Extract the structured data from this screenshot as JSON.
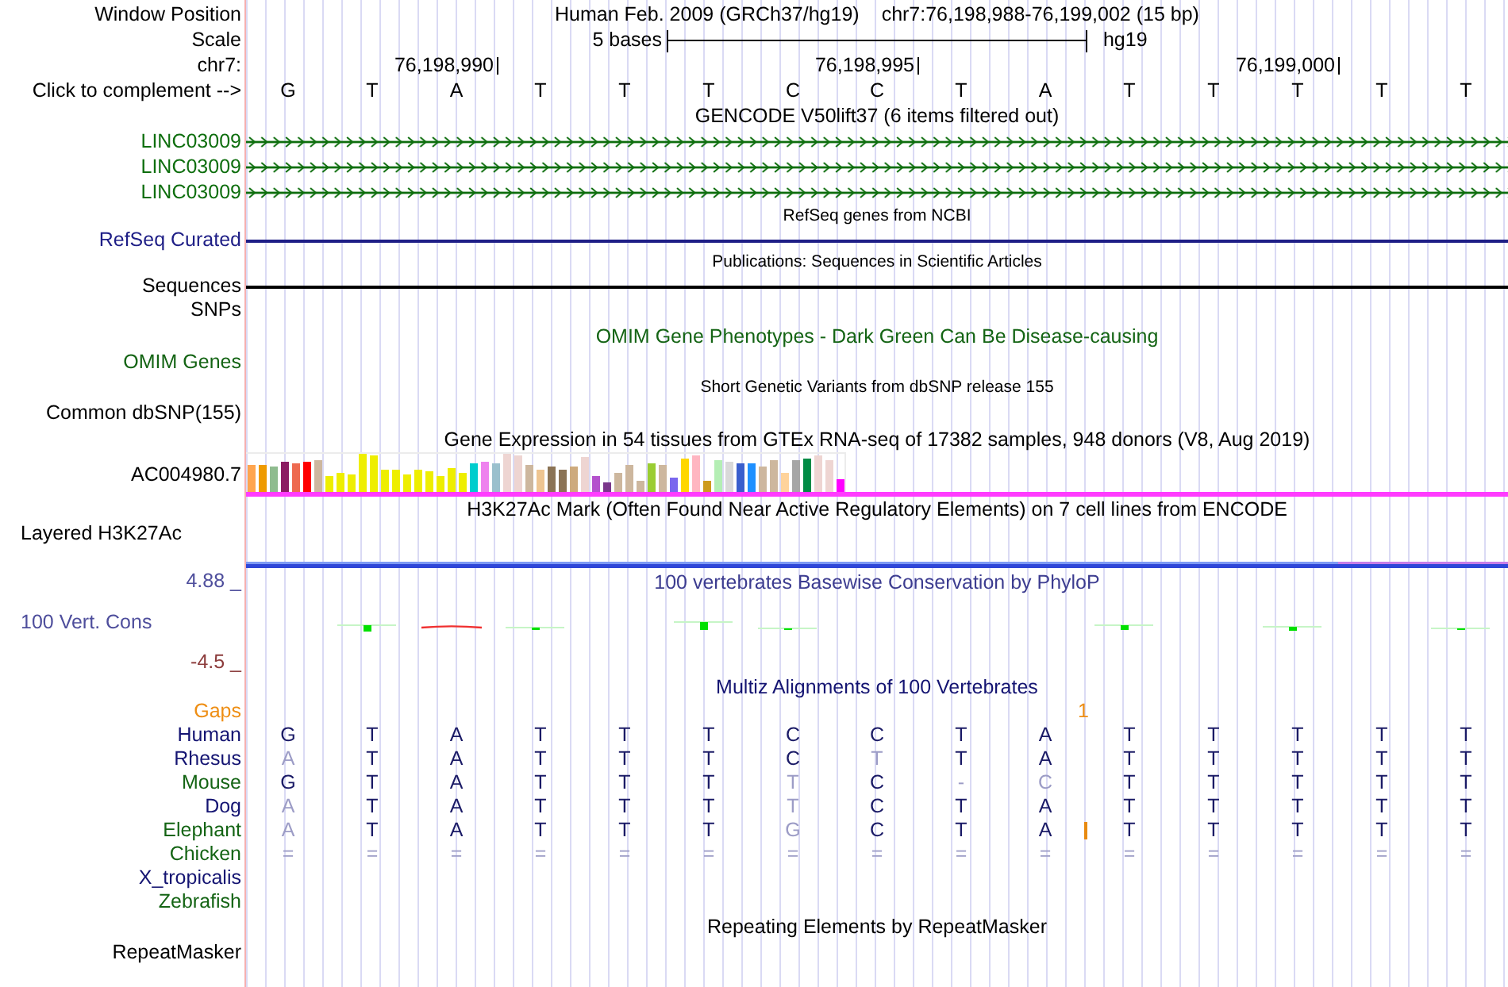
{
  "position": {
    "label": "Window Position",
    "assembly": "Human Feb. 2009 (GRCh37/hg19)",
    "range": "chr7:76,198,988-76,199,002 (15 bp)"
  },
  "scale": {
    "label": "Scale",
    "span": "5 bases",
    "assembly": "hg19"
  },
  "ruler": {
    "label": "chr7:"
  },
  "sequence": {
    "label": "Click to complement -->",
    "bases": [
      {
        "base": "G"
      },
      {
        "base": "T"
      },
      {
        "base": "A",
        "coordinate": "76,198,990"
      },
      {
        "base": "T"
      },
      {
        "base": "T"
      },
      {
        "base": "T"
      },
      {
        "base": "C"
      },
      {
        "base": "C",
        "coordinate": "76,198,995"
      },
      {
        "base": "T"
      },
      {
        "base": "A"
      },
      {
        "base": "T"
      },
      {
        "base": "T"
      },
      {
        "base": "T",
        "coordinate": "76,199,000"
      },
      {
        "base": "T"
      },
      {
        "base": "T"
      }
    ]
  },
  "rows": [
    {
      "kind": "title",
      "text": "GENCODE V50lift37 (6 items filtered out)",
      "color": "#000000"
    },
    {
      "kind": "gene",
      "label": "LINC03009",
      "color": "#0e6e0e"
    },
    {
      "kind": "gene",
      "label": "LINC03009",
      "color": "#0e6e0e"
    },
    {
      "kind": "gene",
      "label": "LINC03009",
      "color": "#0e6e0e"
    },
    {
      "kind": "caption",
      "text": "RefSeq genes from NCBI",
      "color": "#000000"
    },
    {
      "kind": "line",
      "label": "RefSeq Curated",
      "color": "#1e1e86"
    },
    {
      "kind": "caption",
      "text": "Publications: Sequences in Scientific Articles",
      "color": "#000000"
    },
    {
      "kind": "line",
      "label": "Sequences",
      "color": "#000000"
    },
    {
      "kind": "label",
      "label": "SNPs",
      "color": "#000000"
    },
    {
      "kind": "title",
      "text": "OMIM Gene Phenotypes - Dark Green Can Be Disease-causing",
      "color": "#146414"
    },
    {
      "kind": "label",
      "label": "OMIM Genes",
      "color": "#146414"
    },
    {
      "kind": "caption",
      "text": "Short Genetic Variants from dbSNP release 155",
      "color": "#000000"
    },
    {
      "kind": "label",
      "label": "Common dbSNP(155)",
      "color": "#000000"
    },
    {
      "kind": "title",
      "text": "Gene Expression in 54 tissues from GTEx RNA-seq of 17382 samples, 948 donors (V8, Aug 2019)",
      "color": "#000000"
    },
    {
      "kind": "expression",
      "label": "AC004980.7",
      "color": "#000000"
    },
    {
      "kind": "title",
      "text": "H3K27Ac Mark (Often Found Near Active Regulatory Elements) on 7 cell lines from ENCODE",
      "color": "#000000"
    },
    {
      "kind": "signal",
      "label": "Layered H3K27Ac",
      "color": "#000000"
    },
    {
      "kind": "conservation",
      "title": "100 vertebrates Basewise Conservation by PhyloP",
      "label": "100 Vert. Cons",
      "max": "4.88 _",
      "min": "-4.5 _",
      "color": "#4e4e9c"
    },
    {
      "kind": "title",
      "text": "Multiz Alignments of 100 Vertebrates",
      "color": "#141472"
    },
    {
      "kind": "gaps",
      "label": "Gaps",
      "color": "#ee8e14"
    },
    {
      "kind": "species",
      "label": "Human",
      "color": "#141472",
      "bases": [
        {
          "base": "G",
          "match": true
        },
        {
          "base": "T",
          "match": true
        },
        {
          "base": "A",
          "match": true
        },
        {
          "base": "T",
          "match": true
        },
        {
          "base": "T",
          "match": true
        },
        {
          "base": "T",
          "match": true
        },
        {
          "base": "C",
          "match": true
        },
        {
          "base": "C",
          "match": true
        },
        {
          "base": "T",
          "match": true
        },
        {
          "base": "A",
          "match": true
        },
        {
          "base": "T",
          "match": true
        },
        {
          "base": "T",
          "match": true
        },
        {
          "base": "T",
          "match": true
        },
        {
          "base": "T",
          "match": true
        },
        {
          "base": "T",
          "match": true
        }
      ]
    },
    {
      "kind": "species",
      "label": "Rhesus",
      "color": "#141472",
      "bases": [
        {
          "base": "A",
          "match": false
        },
        {
          "base": "T",
          "match": true
        },
        {
          "base": "A",
          "match": true
        },
        {
          "base": "T",
          "match": true
        },
        {
          "base": "T",
          "match": true
        },
        {
          "base": "T",
          "match": true
        },
        {
          "base": "C",
          "match": true
        },
        {
          "base": "T",
          "match": false
        },
        {
          "base": "T",
          "match": true
        },
        {
          "base": "A",
          "match": true
        },
        {
          "base": "T",
          "match": true
        },
        {
          "base": "T",
          "match": true
        },
        {
          "base": "T",
          "match": true
        },
        {
          "base": "T",
          "match": true
        },
        {
          "base": "T",
          "match": true
        }
      ]
    },
    {
      "kind": "species",
      "label": "Mouse",
      "color": "#146414",
      "bases": [
        {
          "base": "G",
          "match": true
        },
        {
          "base": "T",
          "match": true
        },
        {
          "base": "A",
          "match": true
        },
        {
          "base": "T",
          "match": true
        },
        {
          "base": "T",
          "match": true
        },
        {
          "base": "T",
          "match": true
        },
        {
          "base": "T",
          "match": false
        },
        {
          "base": "C",
          "match": true
        },
        {
          "base": "-",
          "match": false
        },
        {
          "base": "C",
          "match": false
        },
        {
          "base": "T",
          "match": true
        },
        {
          "base": "T",
          "match": true
        },
        {
          "base": "T",
          "match": true
        },
        {
          "base": "T",
          "match": true
        },
        {
          "base": "T",
          "match": true
        }
      ]
    },
    {
      "kind": "species",
      "label": "Dog",
      "color": "#141472",
      "bases": [
        {
          "base": "A",
          "match": false
        },
        {
          "base": "T",
          "match": true
        },
        {
          "base": "A",
          "match": true
        },
        {
          "base": "T",
          "match": true
        },
        {
          "base": "T",
          "match": true
        },
        {
          "base": "T",
          "match": true
        },
        {
          "base": "T",
          "match": false
        },
        {
          "base": "C",
          "match": true
        },
        {
          "base": "T",
          "match": true
        },
        {
          "base": "A",
          "match": true
        },
        {
          "base": "T",
          "match": true
        },
        {
          "base": "T",
          "match": true
        },
        {
          "base": "T",
          "match": true
        },
        {
          "base": "T",
          "match": true
        },
        {
          "base": "T",
          "match": true
        }
      ]
    },
    {
      "kind": "species",
      "label": "Elephant",
      "color": "#146414",
      "bases": [
        {
          "base": "A",
          "match": false
        },
        {
          "base": "T",
          "match": true
        },
        {
          "base": "A",
          "match": true
        },
        {
          "base": "T",
          "match": true
        },
        {
          "base": "T",
          "match": true
        },
        {
          "base": "T",
          "match": true
        },
        {
          "base": "G",
          "match": false
        },
        {
          "base": "C",
          "match": true
        },
        {
          "base": "T",
          "match": true
        },
        {
          "base": "A",
          "match": true,
          "insertion": "1"
        },
        {
          "base": "T",
          "match": true
        },
        {
          "base": "T",
          "match": true
        },
        {
          "base": "T",
          "match": true
        },
        {
          "base": "T",
          "match": true
        },
        {
          "base": "T",
          "match": true
        }
      ]
    },
    {
      "kind": "species",
      "label": "Chicken",
      "color": "#146414",
      "bases": [
        {
          "base": "=",
          "match": false
        },
        {
          "base": "=",
          "match": false
        },
        {
          "base": "=",
          "match": false
        },
        {
          "base": "=",
          "match": false
        },
        {
          "base": "=",
          "match": false
        },
        {
          "base": "=",
          "match": false
        },
        {
          "base": "=",
          "match": false
        },
        {
          "base": "=",
          "match": false
        },
        {
          "base": "=",
          "match": false
        },
        {
          "base": "=",
          "match": false
        },
        {
          "base": "=",
          "match": false
        },
        {
          "base": "=",
          "match": false
        },
        {
          "base": "=",
          "match": false
        },
        {
          "base": "=",
          "match": false
        },
        {
          "base": "=",
          "match": false
        }
      ]
    },
    {
      "kind": "species",
      "label": "X_tropicalis",
      "color": "#141472"
    },
    {
      "kind": "species",
      "label": "Zebrafish",
      "color": "#146414"
    },
    {
      "kind": "title",
      "text": "Repeating Elements by RepeatMasker",
      "color": "#000000"
    },
    {
      "kind": "label",
      "label": "RepeatMasker",
      "color": "#000000"
    }
  ]
}
